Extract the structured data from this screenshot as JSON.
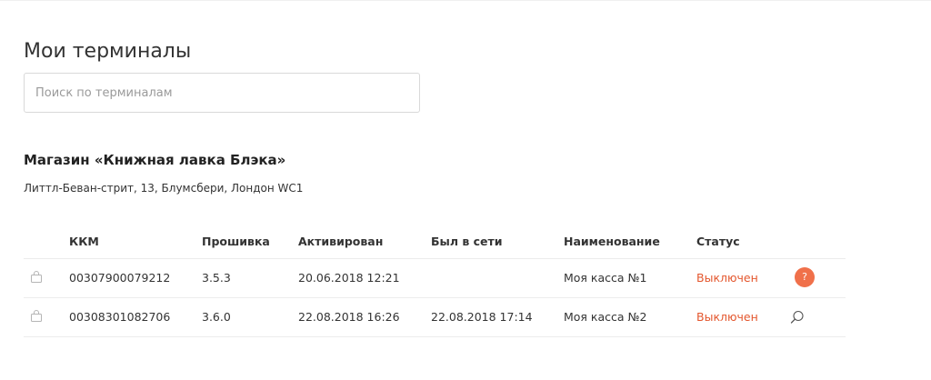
{
  "page": {
    "title": "Мои терминалы"
  },
  "search": {
    "placeholder": "Поиск по терминалам",
    "value": ""
  },
  "store": {
    "name": "Магазин «Книжная лавка Блэка»",
    "address": "Литтл-Беван-стрит, 13, Блумсбери, Лондон WC1"
  },
  "table": {
    "headers": {
      "kkm": "ККМ",
      "firmware": "Прошивка",
      "activated": "Активирован",
      "last_online": "Был в сети",
      "name": "Наименование",
      "status": "Статус"
    },
    "rows": [
      {
        "kkm": "00307900079212",
        "firmware": "3.5.3",
        "activated": "20.06.2018 12:21",
        "last_online": "",
        "name": "Моя касса №1",
        "status": "Выключен",
        "action_icon": "question-icon",
        "action_label": "?"
      },
      {
        "kkm": "00308301082706",
        "firmware": "3.6.0",
        "activated": "22.08.2018 16:26",
        "last_online": "22.08.2018 17:14",
        "name": "Моя касса №2",
        "status": "Выключен",
        "action_icon": "search-icon"
      }
    ]
  },
  "colors": {
    "status_off": "#e4572e",
    "help_badge": "#f0704a"
  }
}
